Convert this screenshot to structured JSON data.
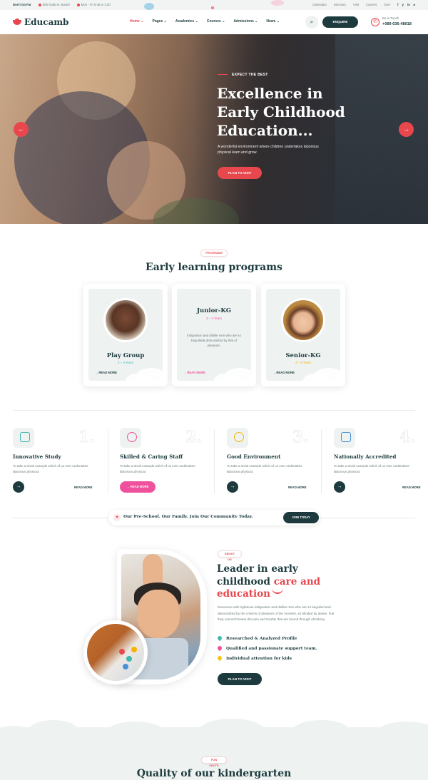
{
  "topbar": {
    "tagline": "Don't Go Far",
    "address": "800 Nulla St. Bostel",
    "hours": "Mon - Fri 9:45 to 3:30",
    "links": [
      "Calendars",
      "Directory",
      "Visit",
      "Careers",
      "Give"
    ],
    "social": [
      "f",
      "y",
      "in",
      "▸"
    ]
  },
  "header": {
    "brand": "Educamb",
    "nav": [
      "Home",
      "Pages",
      "Academics",
      "Courses",
      "Admissions",
      "News"
    ],
    "enquire_label": "ENQUIRE",
    "contact_label": "Be in Touch",
    "phone": "+089 636-48018"
  },
  "hero": {
    "kicker": "EXPECT THE BEST",
    "title": "Excellence in Early Childhood Education...",
    "description": "A wonderful environment where children undertakes laborious physical learn and grow.",
    "cta_label": "PLAN TO VISIT",
    "prev_icon": "←",
    "next_icon": "→"
  },
  "programs": {
    "tag": "PROGRAMS",
    "title": "Early learning programs",
    "cards": [
      {
        "name": "Play Group",
        "age": "2 – 3 Years",
        "more": "READ MORE"
      },
      {
        "name": "Junior-KG",
        "age": "3 – 4 Years",
        "text": "Indignation and dislike men who are so beguiled& demoralized by that of pleasure.",
        "more": "READ MORE"
      },
      {
        "name": "Senior-KG",
        "age": "4 – 5 Years",
        "more": "READ MORE"
      }
    ]
  },
  "features": [
    {
      "num": "1.",
      "title": "Innovative Study",
      "desc": "To take a trivial example which of us ever undertakes laborious physical.",
      "more": "READ MORE",
      "icon": "blocks-icon",
      "color": "#3fb8af"
    },
    {
      "num": "2.",
      "title": "Skilled & Caring Staff",
      "desc": "To take a trivial example which of us ever undertakes laborious physical.",
      "more": "READ MORE",
      "icon": "teacher-icon",
      "color": "#f0519c"
    },
    {
      "num": "3.",
      "title": "Good Environment",
      "desc": "To take a trivial example which of us ever undertakes laborious physical.",
      "more": "READ MORE",
      "icon": "sun-icon",
      "color": "#f5b400"
    },
    {
      "num": "4.",
      "title": "Nationally Accredited",
      "desc": "To take a trivial example which of us ever undertakes laborious physical.",
      "more": "READ MORE",
      "icon": "certificate-icon",
      "color": "#4a90d9"
    }
  ],
  "strip": {
    "text": "Our Pre-School. Our Family. Join Our Community Today.",
    "button": "JOIN TODAY"
  },
  "about": {
    "tag": "ABOUT US",
    "title_a": "Leader in early childhood ",
    "title_b": "care and education",
    "desc": "Denounce with righteous indignation and dislike men who are so beguiled and demoralized by the charms of pleasure of the moment, so blinded by desire, that they cannot foresee the pain and trouble that are bound through shrinking.",
    "checks": [
      {
        "label": "Researched & Analyzed Profile",
        "color": "#3fb8af"
      },
      {
        "label": "Qualified and passionate support team.",
        "color": "#f0519c"
      },
      {
        "label": "Individual attention for kids",
        "color": "#f5c518"
      }
    ],
    "button": "PLAN TO VISIT"
  },
  "facts": {
    "tag": "FUN FACTS",
    "title": "Quality of our kindergarten"
  },
  "colors": {
    "primary": "#1d3b3e",
    "accent": "#e8474e",
    "pink": "#f0519c",
    "teal": "#3fb8af",
    "yellow": "#f5b400"
  }
}
